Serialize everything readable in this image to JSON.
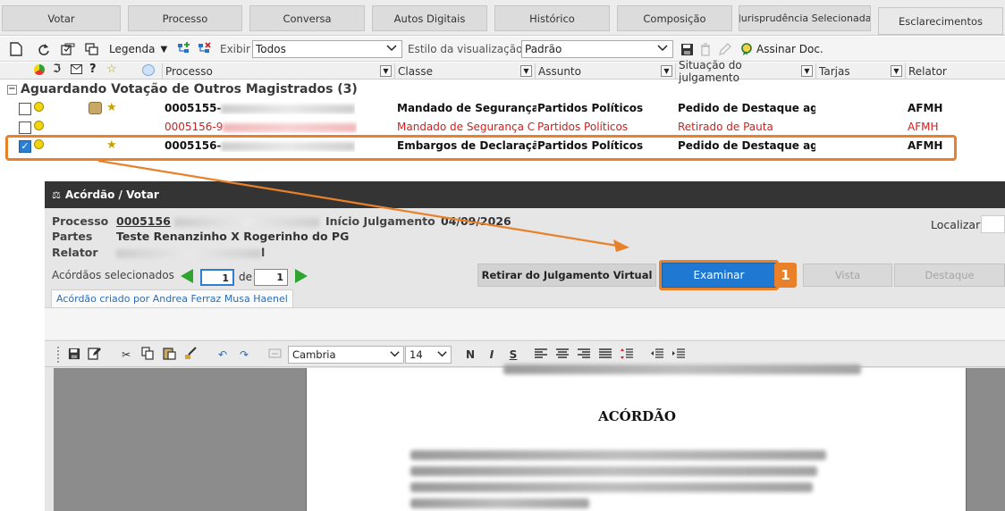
{
  "top_tabs": [
    {
      "label": "Votar"
    },
    {
      "label": "Processo"
    },
    {
      "label": "Conversa"
    },
    {
      "label": "Autos Digitais"
    },
    {
      "label": "Histórico"
    },
    {
      "label": "Composição"
    },
    {
      "label": "Jurisprudência Selecionada"
    },
    {
      "label": "Esclarecimentos"
    }
  ],
  "toolbar": {
    "legenda_label": "Legenda",
    "exibir_label": "Exibir",
    "exibir_value": "Todos",
    "estilo_label": "Estilo da visualização",
    "estilo_value": "Padrão",
    "assinar_label": "Assinar Doc."
  },
  "grid": {
    "columns": [
      "Processo",
      "Classe",
      "Assunto",
      "Situação do julgamento",
      "Tarjas",
      "Relator"
    ],
    "group_title": "Aguardando Votação de Outros Magistrados (3)",
    "rows": [
      {
        "processo": "0005155-",
        "classe": "Mandado de Segurança C",
        "assunto": "Partidos Políticos",
        "situacao": "Pedido de Destaque agu:",
        "relator": "AFMH"
      },
      {
        "processo": "0005156-9",
        "classe": "Mandado de Segurança C",
        "assunto": "Partidos Políticos",
        "situacao": "Retirado de Pauta",
        "relator": "AFMH"
      },
      {
        "processo": "0005156-",
        "classe": "Embargos de Declaração",
        "assunto": "Partidos Políticos",
        "situacao": "Pedido de Destaque agu:",
        "relator": "AFMH"
      }
    ]
  },
  "dialog": {
    "title": "Acórdão / Votar",
    "processo_label": "Processo",
    "processo_value": "0005156",
    "inicio_label": "Início Julgamento",
    "inicio_value": "04/09/2026",
    "partes_label": "Partes",
    "partes_value": "Teste Renanzinho X Rogerinho do PG",
    "relator_label": "Relator",
    "relator_suffix": "l",
    "localizar_label": "Localizar",
    "acordaos_label": "Acórdãos selecionados",
    "pager_current": "1",
    "pager_de": "de",
    "pager_total": "1",
    "btn_retirar": "Retirar do Julgamento Virtual",
    "btn_examinar": "Examinar",
    "btn_vista": "Vista",
    "btn_destaque": "Destaque",
    "badge_number": "1",
    "tab_label": "Acórdão criado por Andrea Ferraz Musa Haenel",
    "editor_font": "Cambria",
    "editor_size": "14",
    "editor_bold": "N",
    "editor_italic": "I",
    "editor_strike": "S",
    "doc_title": "ACÓRDÃO"
  }
}
